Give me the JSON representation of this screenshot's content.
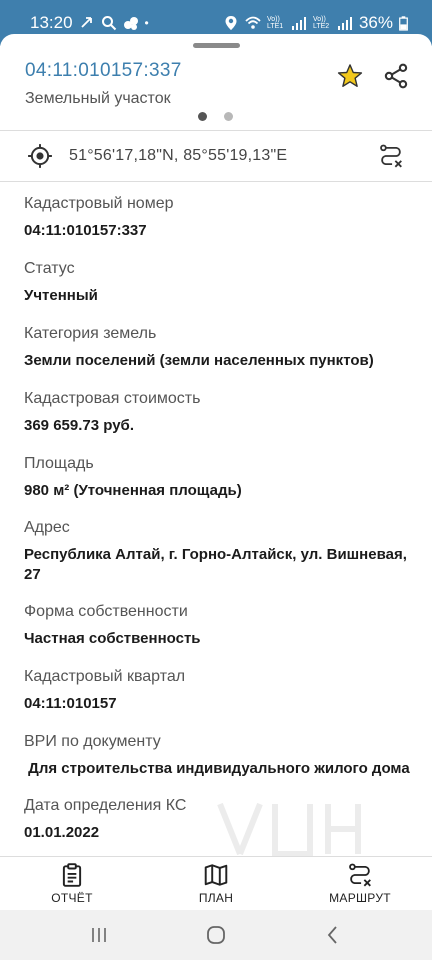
{
  "status_bar": {
    "time": "13:20",
    "battery": "36%",
    "sim1": "Vo)) LTE1",
    "sim2": "Vo)) LTE2"
  },
  "header": {
    "cadastral_title": "04:11:010157:337",
    "subtitle": "Земельный участок",
    "pager": {
      "pages": 2,
      "active": 1
    }
  },
  "coordinates": {
    "text": "51°56'17,18\"N, 85°55'19,13\"E"
  },
  "fields": [
    {
      "label": "Кадастровый номер",
      "value": "04:11:010157:337"
    },
    {
      "label": "Статус",
      "value": "Учтенный"
    },
    {
      "label": "Категория земель",
      "value": "Земли поселений (земли населенных пунктов)"
    },
    {
      "label": "Кадастровая стоимость",
      "value": "369 659.73 руб."
    },
    {
      "label": "Площадь",
      "value": "980 м² (Уточненная площадь)"
    },
    {
      "label": "Адрес",
      "value": "Республика Алтай, г. Горно-Алтайск, ул. Вишневая, 27"
    },
    {
      "label": "Форма собственности",
      "value": "Частная собственность"
    },
    {
      "label": "Кадастровый квартал",
      "value": "04:11:010157"
    },
    {
      "label": "ВРИ по документу",
      "value": " Для строительства индивидуального жилого дома"
    },
    {
      "label": "Дата определения КС",
      "value": "01.01.2022"
    }
  ],
  "tabs": [
    {
      "label": "ОТЧЁТ",
      "icon": "clipboard-icon"
    },
    {
      "label": "ПЛАН",
      "icon": "map-icon"
    },
    {
      "label": "МАРШРУТ",
      "icon": "route-icon"
    }
  ],
  "colors": {
    "status_bar": "#3f7fad",
    "title": "#3d7fae",
    "star": "#f2c81c"
  }
}
